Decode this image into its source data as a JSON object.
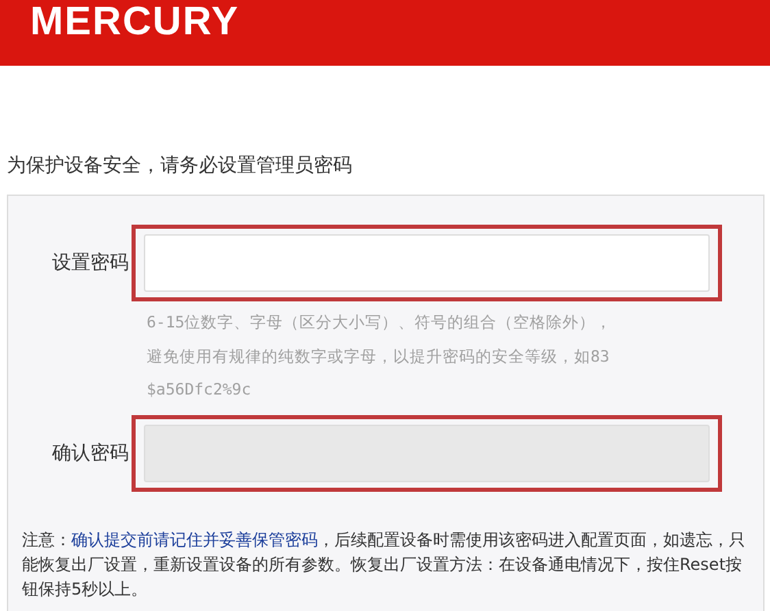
{
  "header": {
    "logo": "MERCURY"
  },
  "intro": "为保护设备安全，请务必设置管理员密码",
  "fields": [
    {
      "label": "设置密码",
      "disabled": false,
      "highlighted": true,
      "hint_lines": [
        "6-15位数字、字母（区分大小写）、符号的组合（空格除外），",
        "避免使用有规律的纯数字或字母，以提升密码的安全等级，如83",
        "$a56Dfc2%9c"
      ]
    },
    {
      "label": "确认密码",
      "disabled": true,
      "highlighted": true
    }
  ],
  "note": {
    "prefix": "注意：",
    "emphasis": "确认提交前请记住并妥善保管密码",
    "rest": "，后续配置设备时需使用该密码进入配置页面，如遗忘，只能恢复出厂设置，重新设置设备的所有参数。恢复出厂设置方法：在设备通电情况下，按住Reset按钮保持5秒以上。"
  }
}
